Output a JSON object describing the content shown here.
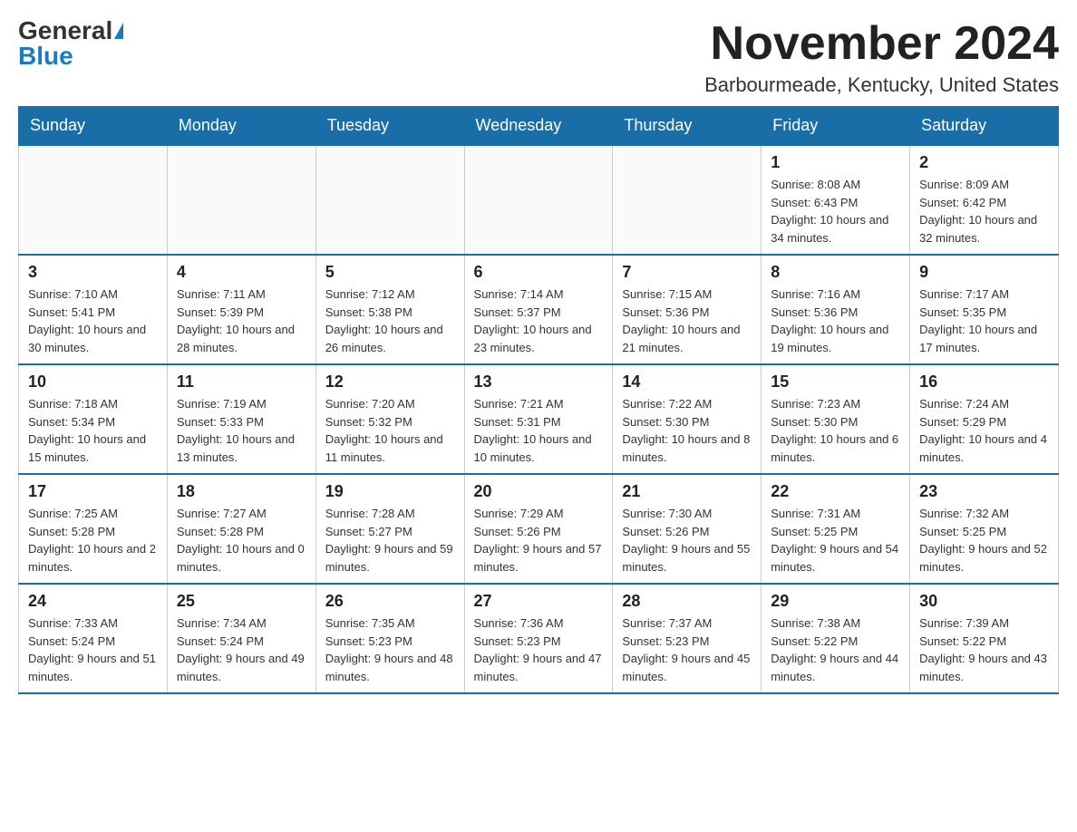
{
  "header": {
    "logo_general": "General",
    "logo_blue": "Blue",
    "month_title": "November 2024",
    "location": "Barbourmeade, Kentucky, United States"
  },
  "weekdays": [
    "Sunday",
    "Monday",
    "Tuesday",
    "Wednesday",
    "Thursday",
    "Friday",
    "Saturday"
  ],
  "weeks": [
    [
      {
        "day": "",
        "info": ""
      },
      {
        "day": "",
        "info": ""
      },
      {
        "day": "",
        "info": ""
      },
      {
        "day": "",
        "info": ""
      },
      {
        "day": "",
        "info": ""
      },
      {
        "day": "1",
        "info": "Sunrise: 8:08 AM\nSunset: 6:43 PM\nDaylight: 10 hours and 34 minutes."
      },
      {
        "day": "2",
        "info": "Sunrise: 8:09 AM\nSunset: 6:42 PM\nDaylight: 10 hours and 32 minutes."
      }
    ],
    [
      {
        "day": "3",
        "info": "Sunrise: 7:10 AM\nSunset: 5:41 PM\nDaylight: 10 hours and 30 minutes."
      },
      {
        "day": "4",
        "info": "Sunrise: 7:11 AM\nSunset: 5:39 PM\nDaylight: 10 hours and 28 minutes."
      },
      {
        "day": "5",
        "info": "Sunrise: 7:12 AM\nSunset: 5:38 PM\nDaylight: 10 hours and 26 minutes."
      },
      {
        "day": "6",
        "info": "Sunrise: 7:14 AM\nSunset: 5:37 PM\nDaylight: 10 hours and 23 minutes."
      },
      {
        "day": "7",
        "info": "Sunrise: 7:15 AM\nSunset: 5:36 PM\nDaylight: 10 hours and 21 minutes."
      },
      {
        "day": "8",
        "info": "Sunrise: 7:16 AM\nSunset: 5:36 PM\nDaylight: 10 hours and 19 minutes."
      },
      {
        "day": "9",
        "info": "Sunrise: 7:17 AM\nSunset: 5:35 PM\nDaylight: 10 hours and 17 minutes."
      }
    ],
    [
      {
        "day": "10",
        "info": "Sunrise: 7:18 AM\nSunset: 5:34 PM\nDaylight: 10 hours and 15 minutes."
      },
      {
        "day": "11",
        "info": "Sunrise: 7:19 AM\nSunset: 5:33 PM\nDaylight: 10 hours and 13 minutes."
      },
      {
        "day": "12",
        "info": "Sunrise: 7:20 AM\nSunset: 5:32 PM\nDaylight: 10 hours and 11 minutes."
      },
      {
        "day": "13",
        "info": "Sunrise: 7:21 AM\nSunset: 5:31 PM\nDaylight: 10 hours and 10 minutes."
      },
      {
        "day": "14",
        "info": "Sunrise: 7:22 AM\nSunset: 5:30 PM\nDaylight: 10 hours and 8 minutes."
      },
      {
        "day": "15",
        "info": "Sunrise: 7:23 AM\nSunset: 5:30 PM\nDaylight: 10 hours and 6 minutes."
      },
      {
        "day": "16",
        "info": "Sunrise: 7:24 AM\nSunset: 5:29 PM\nDaylight: 10 hours and 4 minutes."
      }
    ],
    [
      {
        "day": "17",
        "info": "Sunrise: 7:25 AM\nSunset: 5:28 PM\nDaylight: 10 hours and 2 minutes."
      },
      {
        "day": "18",
        "info": "Sunrise: 7:27 AM\nSunset: 5:28 PM\nDaylight: 10 hours and 0 minutes."
      },
      {
        "day": "19",
        "info": "Sunrise: 7:28 AM\nSunset: 5:27 PM\nDaylight: 9 hours and 59 minutes."
      },
      {
        "day": "20",
        "info": "Sunrise: 7:29 AM\nSunset: 5:26 PM\nDaylight: 9 hours and 57 minutes."
      },
      {
        "day": "21",
        "info": "Sunrise: 7:30 AM\nSunset: 5:26 PM\nDaylight: 9 hours and 55 minutes."
      },
      {
        "day": "22",
        "info": "Sunrise: 7:31 AM\nSunset: 5:25 PM\nDaylight: 9 hours and 54 minutes."
      },
      {
        "day": "23",
        "info": "Sunrise: 7:32 AM\nSunset: 5:25 PM\nDaylight: 9 hours and 52 minutes."
      }
    ],
    [
      {
        "day": "24",
        "info": "Sunrise: 7:33 AM\nSunset: 5:24 PM\nDaylight: 9 hours and 51 minutes."
      },
      {
        "day": "25",
        "info": "Sunrise: 7:34 AM\nSunset: 5:24 PM\nDaylight: 9 hours and 49 minutes."
      },
      {
        "day": "26",
        "info": "Sunrise: 7:35 AM\nSunset: 5:23 PM\nDaylight: 9 hours and 48 minutes."
      },
      {
        "day": "27",
        "info": "Sunrise: 7:36 AM\nSunset: 5:23 PM\nDaylight: 9 hours and 47 minutes."
      },
      {
        "day": "28",
        "info": "Sunrise: 7:37 AM\nSunset: 5:23 PM\nDaylight: 9 hours and 45 minutes."
      },
      {
        "day": "29",
        "info": "Sunrise: 7:38 AM\nSunset: 5:22 PM\nDaylight: 9 hours and 44 minutes."
      },
      {
        "day": "30",
        "info": "Sunrise: 7:39 AM\nSunset: 5:22 PM\nDaylight: 9 hours and 43 minutes."
      }
    ]
  ]
}
